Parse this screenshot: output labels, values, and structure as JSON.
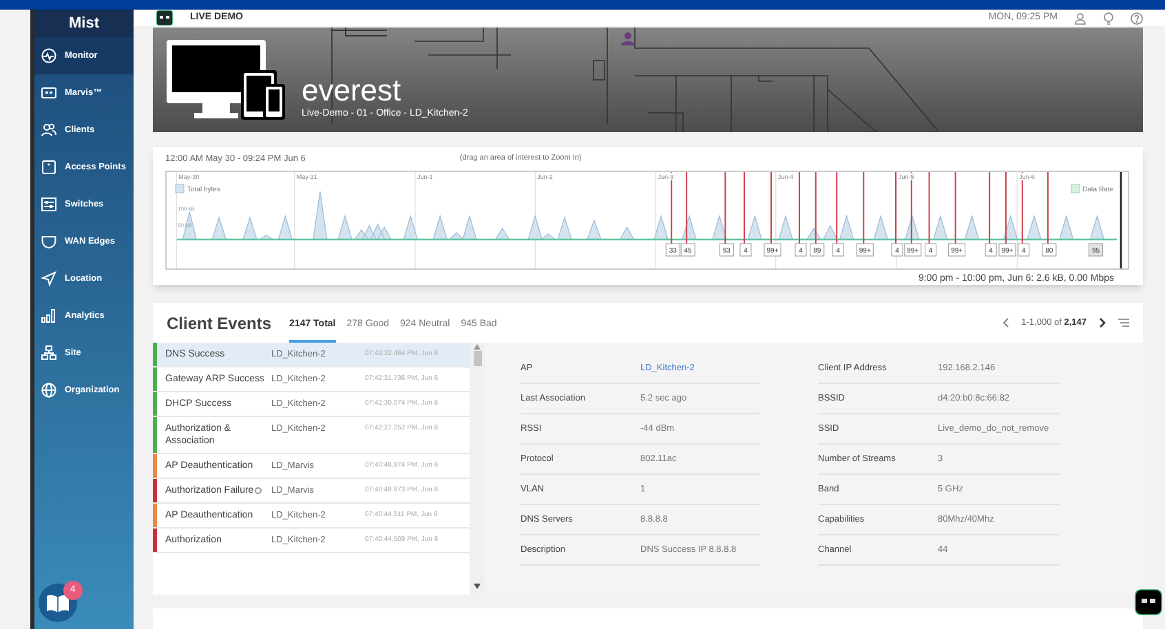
{
  "top_bar": {
    "logo": "Mist",
    "app_label": "LIVE DEMO",
    "clock": "MON, 09:25 PM"
  },
  "sidebar": {
    "items": [
      {
        "label": "Monitor",
        "selected": true
      },
      {
        "label": "Marvis™",
        "selected": false
      },
      {
        "label": "Clients",
        "selected": false
      },
      {
        "label": "Access Points",
        "selected": false
      },
      {
        "label": "Switches",
        "selected": false
      },
      {
        "label": "WAN Edges",
        "selected": false
      },
      {
        "label": "Location",
        "selected": false
      },
      {
        "label": "Analytics",
        "selected": false
      },
      {
        "label": "Site",
        "selected": false
      },
      {
        "label": "Organization",
        "selected": false
      }
    ],
    "help_badge": "4"
  },
  "site": {
    "name": "everest",
    "path": "Live-Demo - 01 - Office - LD_Kitchen-2"
  },
  "timeline": {
    "range": "12:00 AM May 30 - 09:24 PM Jun 6",
    "hint": "(drag an area of interest to Zoom In)",
    "day_labels": [
      "May-30",
      "May-31",
      "Jun-1",
      "Jun-2",
      "Jun-3",
      "Jun-4",
      "Jun-5",
      "Jun-6"
    ],
    "legend": [
      "Total bytes",
      "Data Rate"
    ],
    "y_labels": [
      "100 kB",
      "50 kB"
    ],
    "event_markers": [
      {
        "label": "33",
        "selected": false
      },
      {
        "label": "45",
        "selected": false
      },
      {
        "label": "93",
        "selected": false
      },
      {
        "label": "4",
        "selected": false
      },
      {
        "label": "99+",
        "selected": false
      },
      {
        "label": "4",
        "selected": false
      },
      {
        "label": "89",
        "selected": false
      },
      {
        "label": "4",
        "selected": false
      },
      {
        "label": "99+",
        "selected": false
      },
      {
        "label": "4",
        "selected": false
      },
      {
        "label": "99+",
        "selected": false
      },
      {
        "label": "4",
        "selected": false
      },
      {
        "label": "99+",
        "selected": false
      },
      {
        "label": "4",
        "selected": false
      },
      {
        "label": "99+",
        "selected": false
      },
      {
        "label": "4",
        "selected": false
      },
      {
        "label": "80",
        "selected": false
      },
      {
        "label": "95",
        "selected": true
      }
    ],
    "readout": "9:00 pm - 10:00 pm, Jun 6: 2.6 kB, 0.00 Mbps"
  },
  "client_events": {
    "title": "Client Events",
    "tabs": [
      {
        "label": "2147 Total",
        "selected": true
      },
      {
        "label": "278 Good",
        "selected": false
      },
      {
        "label": "924 Neutral",
        "selected": false
      },
      {
        "label": "945 Bad",
        "selected": false
      }
    ],
    "pagination": {
      "range": "1-1,000 of ",
      "total": "2,147"
    },
    "events": [
      {
        "name": "DNS Success",
        "ap": "LD_Kitchen-2",
        "time": "07:42:32.464 PM, Jun 6",
        "color": "#4caf50",
        "selected": true,
        "info": false
      },
      {
        "name": "Gateway ARP Success",
        "ap": "LD_Kitchen-2",
        "time": "07:42:31.736 PM, Jun 6",
        "color": "#4caf50",
        "selected": false,
        "info": false
      },
      {
        "name": "DHCP Success",
        "ap": "LD_Kitchen-2",
        "time": "07:42:30.074 PM, Jun 6",
        "color": "#4caf50",
        "selected": false,
        "info": false
      },
      {
        "name": "Authorization & Association",
        "ap": "LD_Kitchen-2",
        "time": "07:42:27.252 PM, Jun 6",
        "color": "#4caf50",
        "selected": false,
        "info": false
      },
      {
        "name": "AP Deauthentication",
        "ap": "LD_Marvis",
        "time": "07:40:48.874 PM, Jun 6",
        "color": "#e8894a",
        "selected": false,
        "info": false
      },
      {
        "name": "Authorization Failure",
        "ap": "LD_Marvis",
        "time": "07:40:48.873 PM, Jun 6",
        "color": "#c8303c",
        "selected": false,
        "info": true
      },
      {
        "name": "AP Deauthentication",
        "ap": "LD_Kitchen-2",
        "time": "07:40:44.511 PM, Jun 6",
        "color": "#e8894a",
        "selected": false,
        "info": false
      },
      {
        "name": "Authorization",
        "ap": "LD_Kitchen-2",
        "time": "07:40:44.509 PM, Jun 6",
        "color": "#c8303c",
        "selected": false,
        "info": false
      }
    ],
    "details": {
      "left": [
        {
          "label": "AP",
          "value": "LD_Kitchen-2",
          "kind": "link"
        },
        {
          "label": "Last Association",
          "value": "5.2 sec ago",
          "kind": "text"
        },
        {
          "label": "RSSI",
          "value": "-44 dBm",
          "kind": "text"
        },
        {
          "label": "Protocol",
          "value": "802.11ac",
          "kind": "text"
        },
        {
          "label": "VLAN",
          "value": "1",
          "kind": "text"
        },
        {
          "label": "DNS Servers",
          "value": "8.8.8.8",
          "kind": "text"
        },
        {
          "label": "Description",
          "value": "DNS Success IP 8.8.8.8",
          "kind": "text"
        }
      ],
      "right": [
        {
          "label": "Client IP Address",
          "value": "192.168.2.146",
          "kind": "text"
        },
        {
          "label": "BSSID",
          "value": "d4:20:b0:8c:66:82",
          "kind": "text"
        },
        {
          "label": "SSID",
          "value": "Live_demo_do_not_remove",
          "kind": "text"
        },
        {
          "label": "Number of Streams",
          "value": "3",
          "kind": "text"
        },
        {
          "label": "Band",
          "value": "5 GHz",
          "kind": "text"
        },
        {
          "label": "Capabilities",
          "value": "80Mhz/40Mhz",
          "kind": "text"
        },
        {
          "label": "Channel",
          "value": "44",
          "kind": "text"
        }
      ]
    }
  }
}
